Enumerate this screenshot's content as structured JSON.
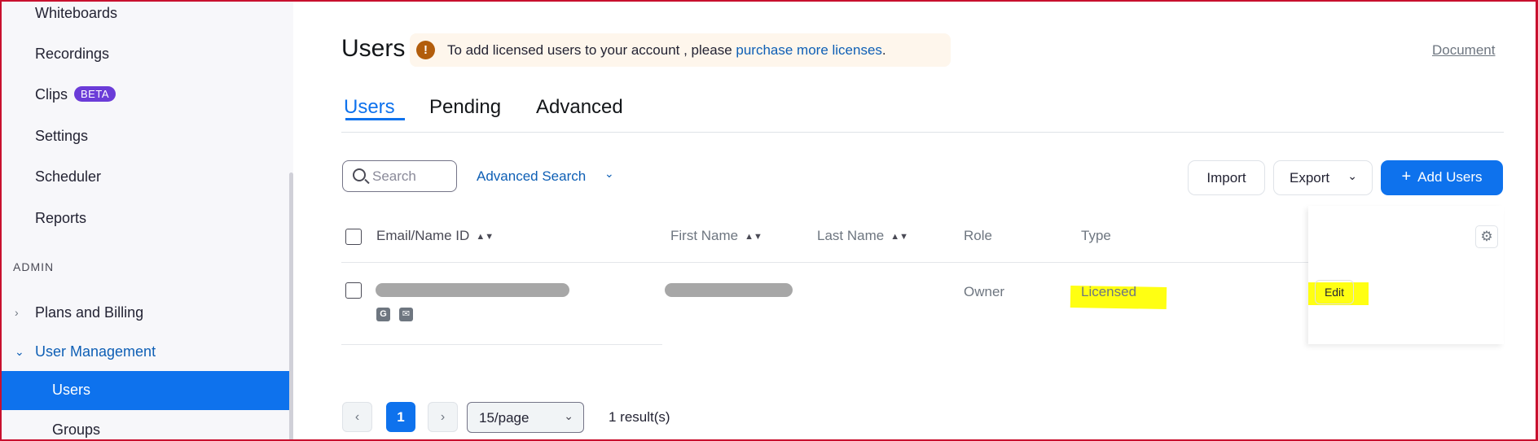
{
  "sidebar": {
    "items": [
      {
        "label": "Whiteboards"
      },
      {
        "label": "Recordings"
      },
      {
        "label": "Clips",
        "badge": "BETA"
      },
      {
        "label": "Settings"
      },
      {
        "label": "Scheduler"
      },
      {
        "label": "Reports"
      }
    ],
    "section": "ADMIN",
    "plans_billing": "Plans and Billing",
    "user_management": "User Management",
    "users": "Users",
    "groups": "Groups"
  },
  "header": {
    "title": "Users",
    "notice_text": "To add licensed users to your account ,  please ",
    "notice_link": "purchase more licenses",
    "notice_end": ".",
    "document_link": "Document"
  },
  "tabs": [
    {
      "label": "Users",
      "active": true
    },
    {
      "label": "Pending",
      "active": false
    },
    {
      "label": "Advanced",
      "active": false
    }
  ],
  "toolbar": {
    "search_placeholder": "Search",
    "advanced_search": "Advanced Search",
    "import": "Import",
    "export": "Export",
    "add_users": "Add Users"
  },
  "table": {
    "columns": [
      "Email/Name ID",
      "First Name",
      "Last Name",
      "Role",
      "Type"
    ],
    "rows": [
      {
        "email": "",
        "first_name": "",
        "last_name": "",
        "role": "Owner",
        "type": "Licensed",
        "action": "Edit"
      }
    ]
  },
  "pagination": {
    "current_page": "1",
    "page_size": "15/page",
    "results": "1 result(s)"
  },
  "colors": {
    "accent": "#0e72ed",
    "link": "#0e5fb5",
    "highlight": "#ffff12",
    "notice_bg": "#fef6ec",
    "beta_badge": "#6b3cd8"
  }
}
